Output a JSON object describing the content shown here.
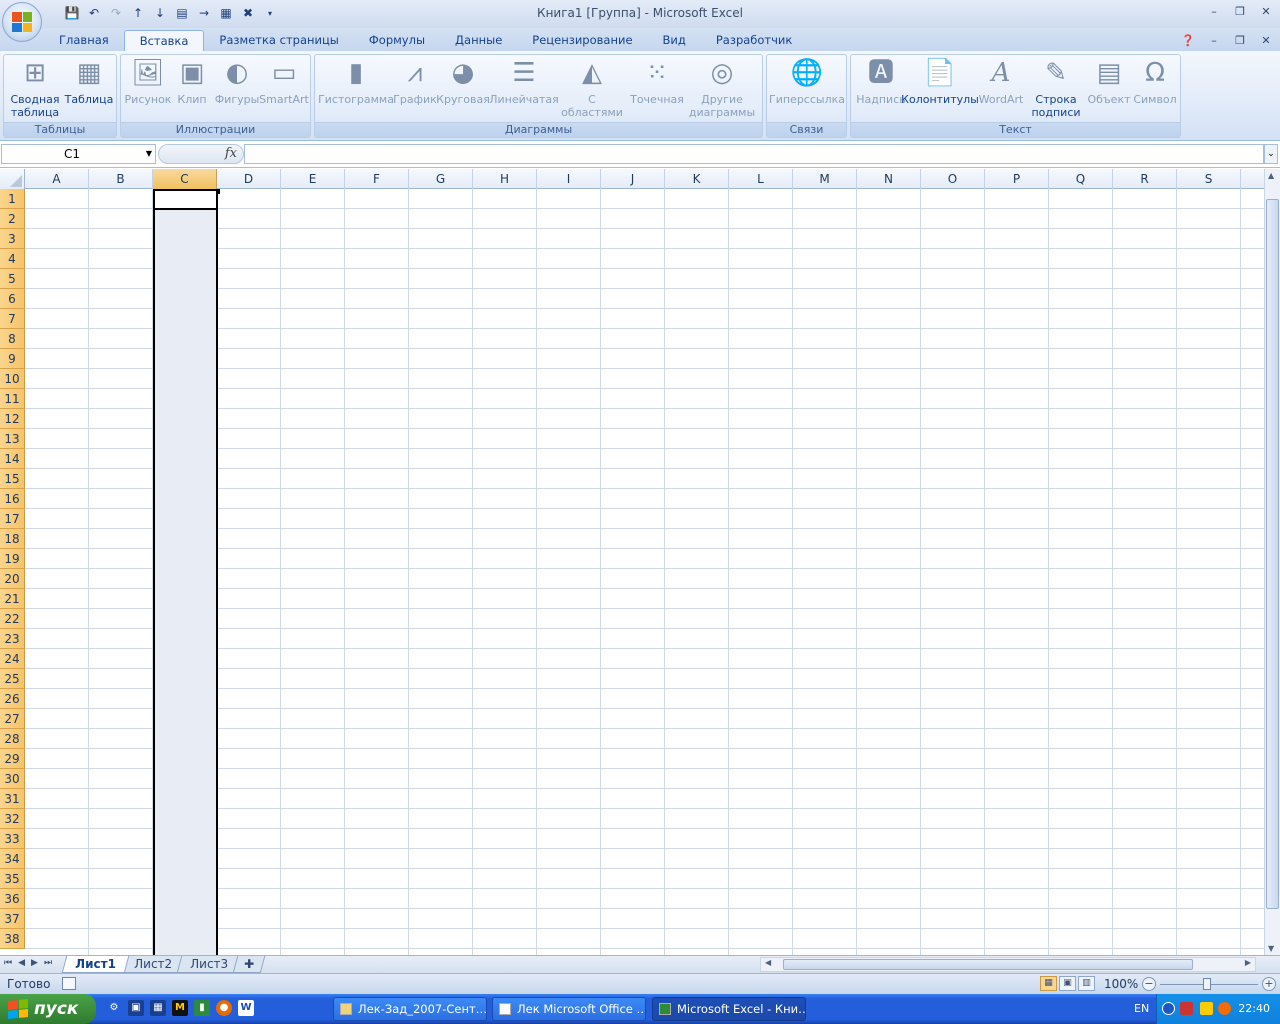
{
  "window": {
    "title": "Книга1  [Группа] - Microsoft Excel"
  },
  "quick_access": [
    "save-icon",
    "undo-icon",
    "redo-icon",
    "sort-asc-icon",
    "sort-desc-icon",
    "form-icon",
    "arrow-icon",
    "print-preview-icon",
    "close-icon",
    "customize-icon"
  ],
  "tabs": [
    {
      "label": "Главная"
    },
    {
      "label": "Вставка"
    },
    {
      "label": "Разметка страницы"
    },
    {
      "label": "Формулы"
    },
    {
      "label": "Данные"
    },
    {
      "label": "Рецензирование"
    },
    {
      "label": "Вид"
    },
    {
      "label": "Разработчик"
    }
  ],
  "active_tab": "Вставка",
  "ribbon": {
    "groups": {
      "tables": "Таблицы",
      "illustrations": "Иллюстрации",
      "charts": "Диаграммы",
      "links": "Связи",
      "text": "Текст"
    },
    "buttons": {
      "pivot": [
        "Сводная",
        "таблица"
      ],
      "table": "Таблица",
      "picture": "Рисунок",
      "clip": "Клип",
      "shapes": "Фигуры",
      "smartart": "SmartArt",
      "histogram": "Гистограмма",
      "line": "График",
      "pie": "Круговая",
      "bar": "Линейчатая",
      "area": [
        "С",
        "областями"
      ],
      "scatter": "Точечная",
      "other": [
        "Другие",
        "диаграммы"
      ],
      "hyperlink": "Гиперссылка",
      "textbox": "Надпись",
      "headerfooter": "Колонтитулы",
      "wordart": "WordArt",
      "signature": [
        "Строка",
        "подписи"
      ],
      "object": "Объект",
      "symbol": "Символ"
    }
  },
  "formula_bar": {
    "name_box": "C1",
    "fx_label": "fx",
    "value": ""
  },
  "columns": [
    "A",
    "B",
    "C",
    "D",
    "E",
    "F",
    "G",
    "H",
    "I",
    "J",
    "K",
    "L",
    "M",
    "N",
    "O",
    "P",
    "Q",
    "R",
    "S"
  ],
  "selected_column": "C",
  "rows": [
    "1",
    "2",
    "3",
    "4",
    "5",
    "6",
    "7",
    "8",
    "9",
    "10",
    "11",
    "12",
    "13",
    "14",
    "15",
    "16",
    "17",
    "18",
    "19",
    "20",
    "21",
    "22",
    "23",
    "24",
    "25",
    "26",
    "27",
    "28",
    "29",
    "30",
    "31",
    "32",
    "33",
    "34",
    "35",
    "36",
    "37",
    "38"
  ],
  "sheets": [
    "Лист1",
    "Лист2",
    "Лист3"
  ],
  "active_sheet": "Лист1",
  "status": {
    "text": "Готово",
    "zoom": "100%"
  },
  "taskbar": {
    "start_label": "пуск",
    "tasks": [
      "Лек-Зад_2007-Сент…",
      "Лек Microsoft Office …",
      "Microsoft Excel - Кни…"
    ],
    "active_task": 2,
    "lang": "EN",
    "clock": "22:40"
  },
  "colors": {
    "accent": "#15428b",
    "selected_header": "#f6c36a",
    "taskbar": "#245edb",
    "start": "#3c8f3b"
  }
}
